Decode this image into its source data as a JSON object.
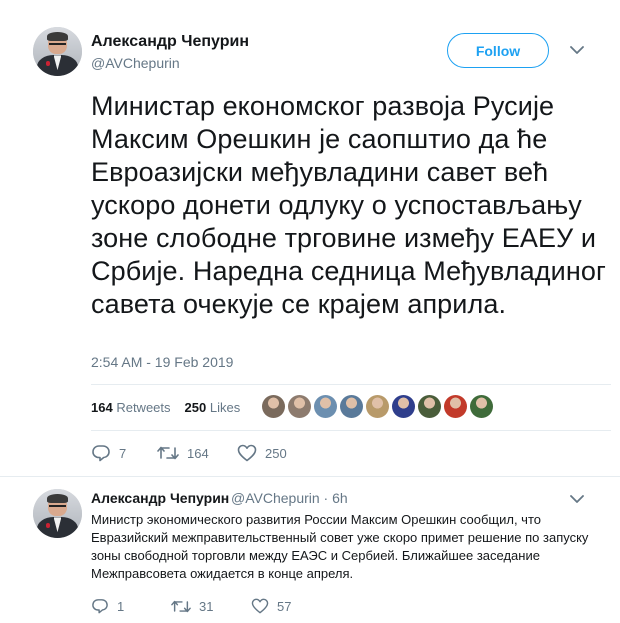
{
  "main_tweet": {
    "author_name": "Александр Чепурин",
    "author_handle": "@AVChepurin",
    "follow_label": "Follow",
    "text": "Министар економског развоја Русије Максим Орешкин је саопштио да ће Евроазијски међувладини савет већ ускоро донети одлуку о успостављању зоне слободне трговине између ЕАЕУ и Србије. Наредна седница Међувладиног савета очекује се крајем априла.",
    "timestamp": "2:54 AM - 19 Feb 2019",
    "retweets_count": "164",
    "retweets_label": "Retweets",
    "likes_count": "250",
    "likes_label": "Likes",
    "likers": [
      "#7a6a5c",
      "#8d7b6e",
      "#6c8fb0",
      "#5a7a9a",
      "#b89a6a",
      "#2f3e8c",
      "#4a5d3a",
      "#c23a2a",
      "#3f6b3a"
    ],
    "actions": {
      "reply": "7",
      "retweet": "164",
      "like": "250"
    }
  },
  "reply_tweet": {
    "author_name": "Александр Чепурин",
    "author_handle": "@AVChepurin",
    "time_ago": "6h",
    "text": "Министр экономического развития России Максим Орешкин сообщил, что Евразийский межправительственный совет уже скоро примет решение по запуску зоны свободной торговли между ЕАЭС и Сербией. Ближайшее заседание Межправсовета ожидается в конце апреля.",
    "actions": {
      "reply": "1",
      "retweet": "31",
      "like": "57"
    }
  },
  "colors": {
    "accent": "#1da1f2",
    "muted": "#657786",
    "divider": "#e6ecf0"
  }
}
